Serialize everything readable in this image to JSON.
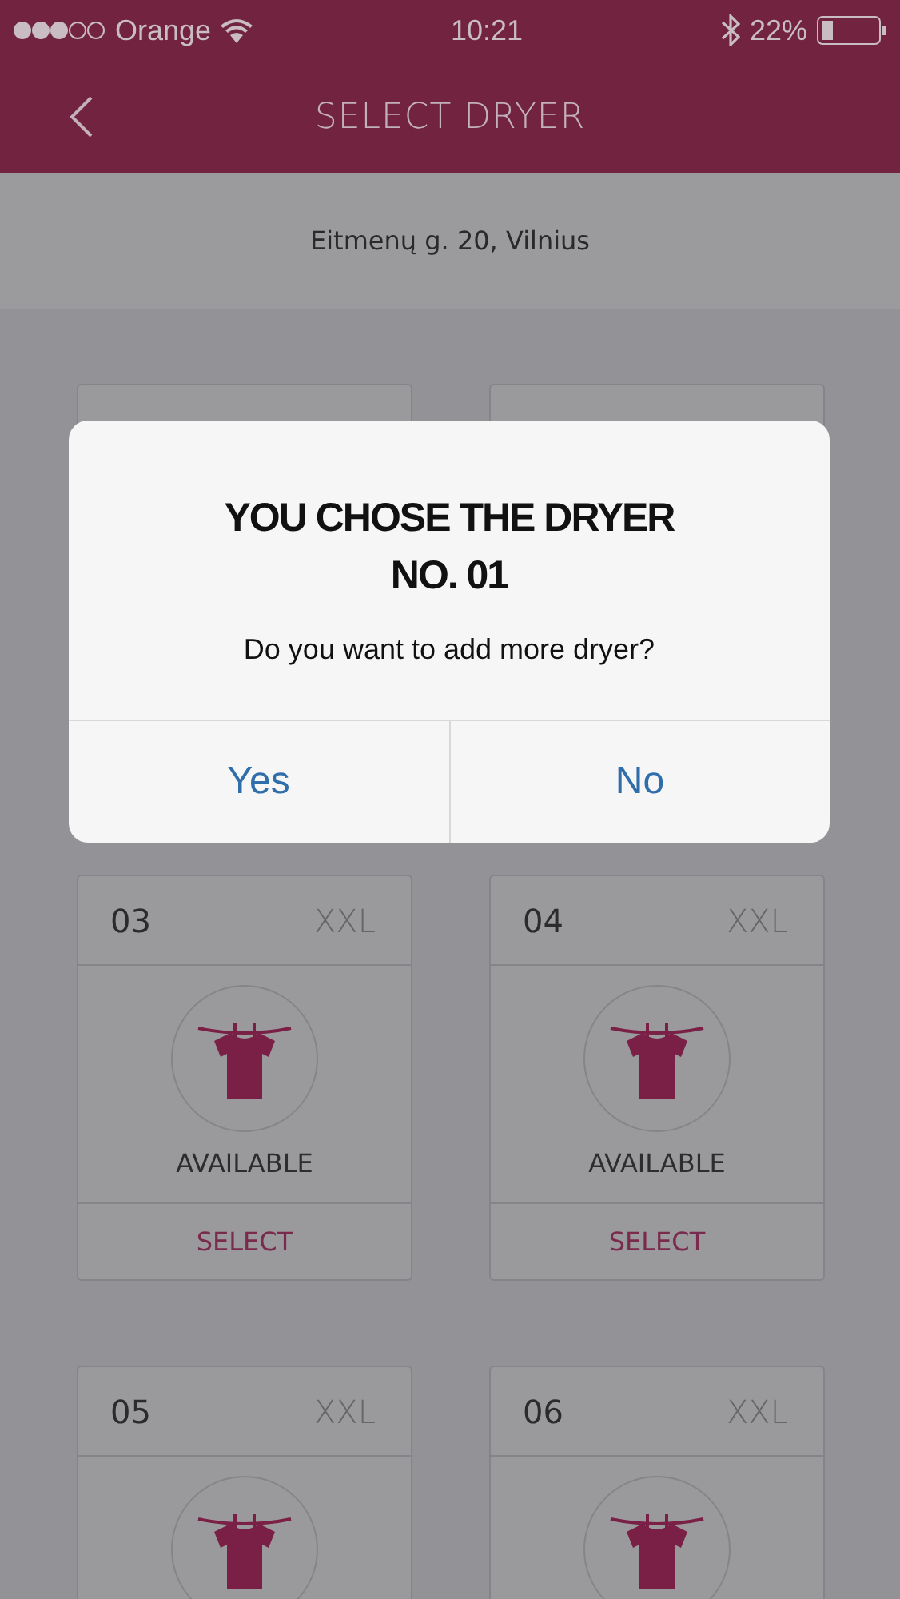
{
  "status_bar": {
    "carrier": "Orange",
    "time": "10:21",
    "battery": "22%"
  },
  "header": {
    "title": "SELECT DRYER"
  },
  "address": "Eitmenų g. 20, Vilnius",
  "dryers": [
    {
      "number": "03",
      "size": "XXL",
      "status": "AVAILABLE",
      "action": "SELECT"
    },
    {
      "number": "04",
      "size": "XXL",
      "status": "AVAILABLE",
      "action": "SELECT"
    },
    {
      "number": "05",
      "size": "XXL"
    },
    {
      "number": "06",
      "size": "XXL"
    }
  ],
  "dialog": {
    "title_lines": [
      "YOU CHOSE THE DRYER",
      "NO. 01"
    ],
    "message": "Do you want to add more dryer?",
    "buttons": [
      "Yes",
      "No"
    ]
  }
}
